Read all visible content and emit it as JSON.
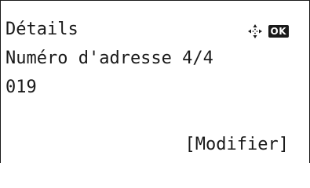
{
  "screen": {
    "title": "Détails",
    "address_line": "Numéro d'adresse 4/4",
    "value": "019",
    "softkey_label": "[Modifier]"
  },
  "indicators": {
    "navigation_icon": "dpad-arrows-icon",
    "ok_label": "OK"
  },
  "colors": {
    "text": "#1a1a1a",
    "background": "#ffffff"
  }
}
